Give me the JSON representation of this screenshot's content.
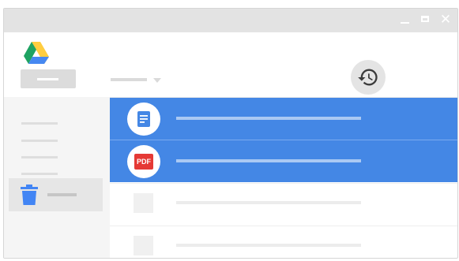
{
  "window": {
    "controls": {
      "minimize_icon": "minimize-icon",
      "maximize_icon": "maximize-icon",
      "close_glyph": "✕"
    }
  },
  "header": {
    "logo_icon": "google-drive-logo",
    "history_icon": "history-icon"
  },
  "sidebar": {
    "trash_icon": "trash-icon"
  },
  "files": [
    {
      "type": "doc",
      "icon": "document-icon",
      "selected": true
    },
    {
      "type": "pdf",
      "icon": "pdf-icon",
      "badge": "PDF",
      "selected": true
    },
    {
      "type": "placeholder",
      "selected": false
    },
    {
      "type": "placeholder",
      "selected": false
    }
  ],
  "colors": {
    "selection": "#4487e5",
    "pdf_badge": "#e53935",
    "trash": "#4285f4",
    "drive_green": "#1ea362",
    "drive_yellow": "#ffcd40",
    "drive_blue": "#4688f1"
  }
}
